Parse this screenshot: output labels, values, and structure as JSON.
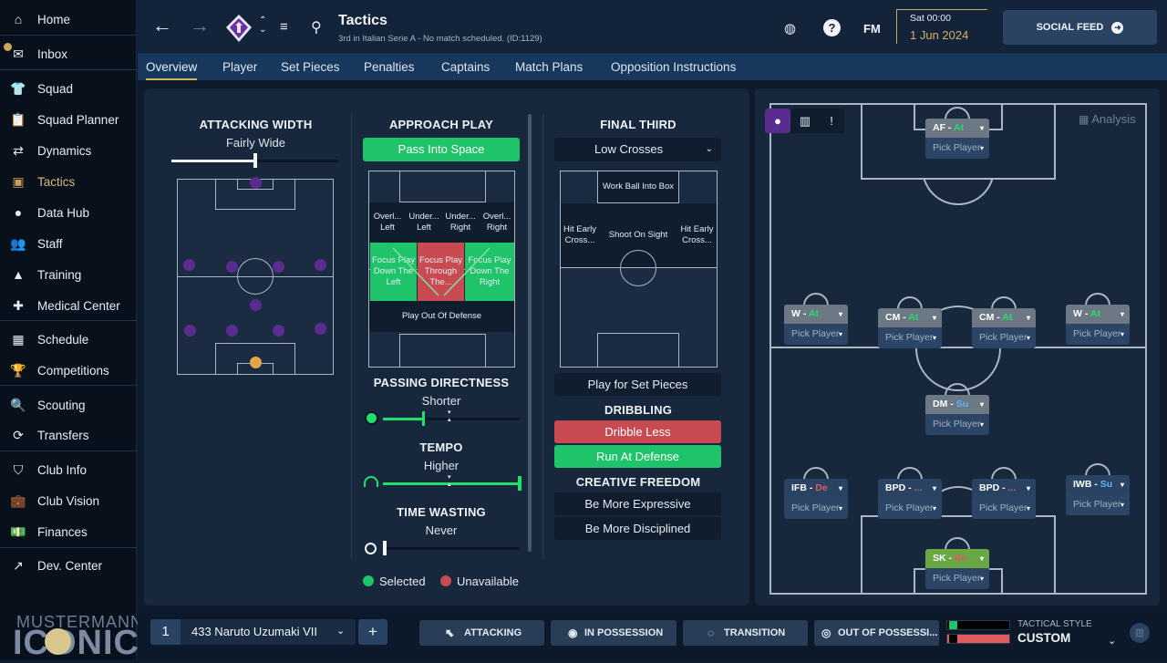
{
  "sidebar": {
    "items": [
      {
        "label": "Home",
        "icon": "home-icon"
      },
      {
        "label": "Inbox",
        "icon": "inbox-icon"
      },
      {
        "label": "Squad",
        "icon": "shirt-icon"
      },
      {
        "label": "Squad Planner",
        "icon": "clipboard-icon"
      },
      {
        "label": "Dynamics",
        "icon": "dynamics-icon"
      },
      {
        "label": "Tactics",
        "icon": "tactics-icon"
      },
      {
        "label": "Data Hub",
        "icon": "data-hub-icon"
      },
      {
        "label": "Staff",
        "icon": "staff-icon"
      },
      {
        "label": "Training",
        "icon": "cone-icon"
      },
      {
        "label": "Medical Center",
        "icon": "medical-icon"
      },
      {
        "label": "Schedule",
        "icon": "calendar-icon"
      },
      {
        "label": "Competitions",
        "icon": "trophy-icon"
      },
      {
        "label": "Scouting",
        "icon": "search-icon"
      },
      {
        "label": "Transfers",
        "icon": "transfer-icon"
      },
      {
        "label": "Club Info",
        "icon": "shield-icon"
      },
      {
        "label": "Club Vision",
        "icon": "briefcase-icon"
      },
      {
        "label": "Finances",
        "icon": "money-icon"
      },
      {
        "label": "Dev. Center",
        "icon": "dev-center-icon"
      }
    ],
    "brand_top": "MUSTERMANN",
    "brand_big": "ICONIC"
  },
  "header": {
    "title": "Tactics",
    "subtitle": "3rd in Italian Serie A - No match scheduled. (ID:1129)",
    "fm_label": "FM",
    "date_day": "Sat 00:00",
    "date": "1 Jun 2024",
    "social_feed": "SOCIAL FEED"
  },
  "tabs": [
    "Overview",
    "Player",
    "Set Pieces",
    "Penalties",
    "Captains",
    "Match Plans",
    "Opposition Instructions"
  ],
  "attacking_width": {
    "title": "ATTACKING WIDTH",
    "value": "Fairly Wide",
    "level": 0.5
  },
  "approach_play": {
    "title": "APPROACH PLAY",
    "selected": "Pass Into Space",
    "cells": [
      "Overl... Left",
      "Under... Left",
      "Under... Right",
      "Overl... Right",
      "Focus Play Down The Left",
      "Focus Play Through The...",
      "Focus Play Down The Right",
      "Play Out Of Defense"
    ]
  },
  "passing_directness": {
    "title": "PASSING DIRECTNESS",
    "value": "Shorter",
    "level": 0.3
  },
  "tempo": {
    "title": "TEMPO",
    "value": "Higher",
    "level": 1.0
  },
  "time_wasting": {
    "title": "TIME WASTING",
    "value": "Never",
    "level": 0.0
  },
  "legend": {
    "selected": "Selected",
    "unavailable": "Unavailable"
  },
  "final_third": {
    "title": "FINAL THIRD",
    "dropdown": "Low Crosses",
    "cells": [
      "Work Ball Into Box",
      "Hit Early Cross...",
      "Shoot On Sight",
      "Hit Early Cross..."
    ],
    "set_pieces": "Play for Set Pieces"
  },
  "dribbling": {
    "title": "DRIBBLING",
    "less": "Dribble Less",
    "run": "Run At Defense"
  },
  "creative_freedom": {
    "title": "CREATIVE FREEDOM",
    "expressive": "Be More Expressive",
    "disciplined": "Be More Disciplined"
  },
  "formation_pitch": {
    "analysis": "Analysis",
    "pick": "Pick Player",
    "roles": [
      {
        "name": "AF",
        "duty": "At"
      },
      {
        "name": "W",
        "duty": "At"
      },
      {
        "name": "CM",
        "duty": "At"
      },
      {
        "name": "CM",
        "duty": "At"
      },
      {
        "name": "W",
        "duty": "At"
      },
      {
        "name": "DM",
        "duty": "Su"
      },
      {
        "name": "IFB",
        "duty": "De"
      },
      {
        "name": "BPD",
        "duty": "..."
      },
      {
        "name": "BPD",
        "duty": "..."
      },
      {
        "name": "IWB",
        "duty": "Su"
      },
      {
        "name": "SK",
        "duty": "De"
      }
    ]
  },
  "bottom": {
    "slot": "1",
    "tactic_name": "433 Naruto Uzumaki VII",
    "add": "+",
    "attacking": "ATTACKING",
    "in_possession": "IN POSSESSION",
    "transition": "TRANSITION",
    "out_of_possession": "OUT OF POSSESSI...",
    "tactical_style_label": "TACTICAL STYLE",
    "tactical_style": "CUSTOM"
  },
  "colors": {
    "accent": "#1fc46a",
    "unavailable": "#c94b52",
    "club": "#5b2c8f",
    "gold": "#d8b05c"
  }
}
